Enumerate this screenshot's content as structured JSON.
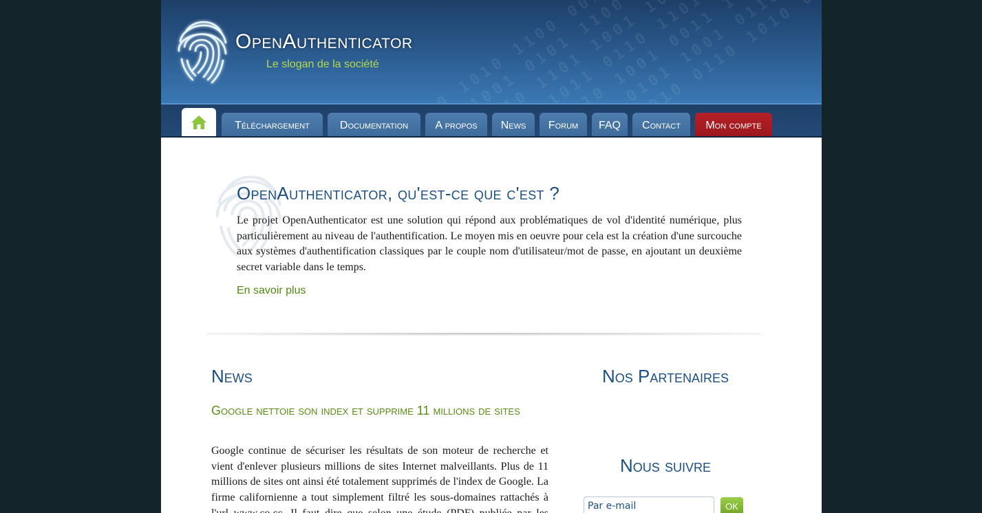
{
  "header": {
    "site_title": "OpenAuthenticator",
    "slogan": "Le slogan de la société",
    "logo_icon": "fingerprint-icon"
  },
  "nav": {
    "home_icon": "home-icon",
    "items": [
      {
        "label": "Téléchargement"
      },
      {
        "label": "Documentation"
      },
      {
        "label": "A propos"
      },
      {
        "label": "News"
      },
      {
        "label": "Forum"
      },
      {
        "label": "FAQ"
      },
      {
        "label": "Contact"
      },
      {
        "label": "Mon compte"
      }
    ]
  },
  "intro": {
    "title": "OpenAuthenticator, qu'est-ce que c'est ?",
    "text": "Le projet OpenAuthenticator est une solution qui répond aux problématiques de vol d'identité numérique, plus particulièrement au niveau de l'authentification. Le moyen mis en oeuvre pour cela est la création d'une surcouche aux systèmes d'authentification classiques par le couple nom d'utilisateur/mot de passe, en ajoutant un deuxième secret variable dans le temps.",
    "link": "En savoir plus"
  },
  "news": {
    "heading": "News",
    "article_title": "Google nettoie son index et supprime 11 millions de sites",
    "article_text": "Google continue de sécuriser les résultats de son moteur de recherche et vient d'enlever plusieurs millions de sites Internet malveillants. Plus de 11 millions de sites ont ainsi été totalement supprimés de l'index de Google. La firme californienne a tout simplement filtré les sous-domaines rattachés à l'url www.co.cc. Il faut dire que selon une étude (PDF) publiée par les experts du"
  },
  "sidebar": {
    "partners_heading": "Nos Partenaires",
    "follow_heading": "Nous suivre",
    "email_placeholder": "Par e-mail",
    "ok_label": "OK"
  },
  "colors": {
    "background": "#13242b",
    "header_blue": "#29578a",
    "heading_blue": "#1d4f7e",
    "accent_green": "#5a8a14",
    "account_red": "#b32127"
  }
}
